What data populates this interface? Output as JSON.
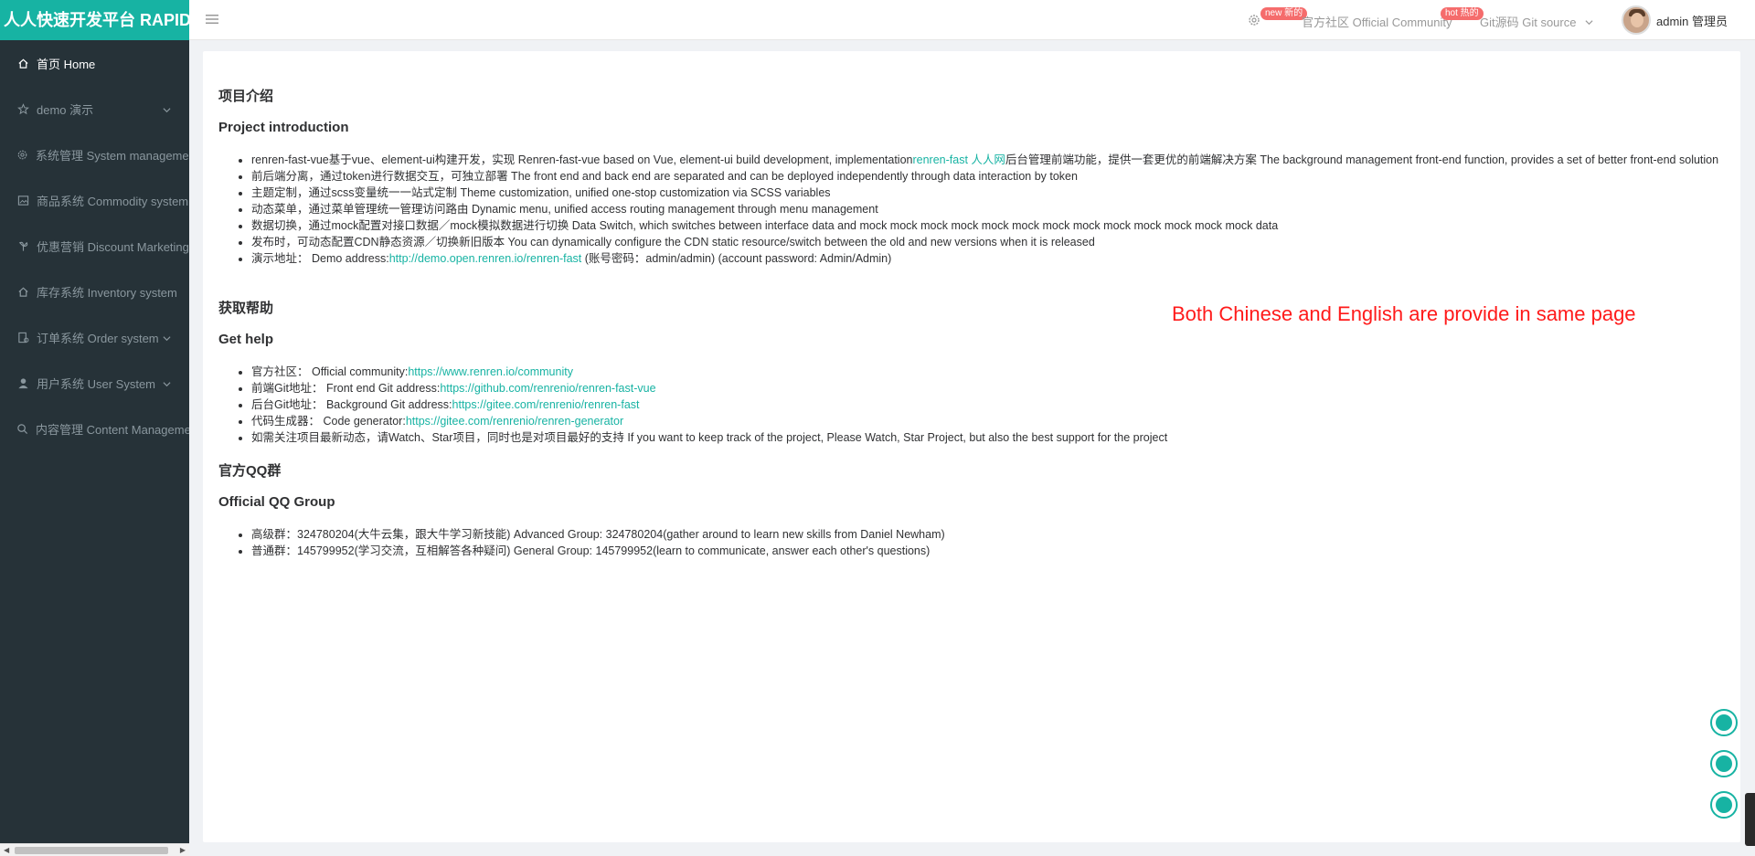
{
  "brand": {
    "title": "人人快速开发平台 RAPID"
  },
  "sidebar": {
    "items": [
      {
        "label": "首页 Home",
        "icon": "home-icon",
        "has_arrow": false,
        "active": true
      },
      {
        "label": "demo 演示",
        "icon": "star-icon",
        "has_arrow": true
      },
      {
        "label": "系统管理 System management",
        "icon": "gear-icon",
        "has_arrow": false
      },
      {
        "label": "商品系统 Commodity system",
        "icon": "picture-icon",
        "has_arrow": false
      },
      {
        "label": "优惠营销 Discount Marketing",
        "icon": "fan-icon",
        "has_arrow": false
      },
      {
        "label": "库存系统 Inventory system",
        "icon": "home-icon",
        "has_arrow": false
      },
      {
        "label": "订单系统 Order system",
        "icon": "order-icon",
        "has_arrow": true
      },
      {
        "label": "用户系统 User System",
        "icon": "user-icon",
        "has_arrow": true
      },
      {
        "label": "内容管理 Content Management",
        "icon": "search-icon",
        "has_arrow": false
      }
    ]
  },
  "topbar": {
    "community_badge": "new 新的",
    "community_label": "官方社区 Official Community",
    "git_badge": "hot 热的",
    "git_label": "Git源码 Git source",
    "username": "admin 管理员"
  },
  "content": {
    "section1": {
      "title_cn": "项目介绍",
      "title_en": "Project introduction",
      "items": [
        {
          "pre": "renren-fast-vue基于vue、element-ui构建开发，实现 Renren-fast-vue based on Vue, element-ui build development, implementation",
          "link": "renren-fast 人人网",
          "post": "后台管理前端功能，提供一套更优的前端解决方案 The background management front-end function, provides a set of better front-end solution"
        },
        {
          "pre": "前后端分离，通过token进行数据交互，可独立部署 The front end and back end are separated and can be deployed independently through data interaction by token",
          "link": "",
          "post": ""
        },
        {
          "pre": "主题定制，通过scss变量统一一站式定制 Theme customization, unified one-stop customization via SCSS variables",
          "link": "",
          "post": ""
        },
        {
          "pre": "动态菜单，通过菜单管理统一管理访问路由 Dynamic menu, unified access routing management through menu management",
          "link": "",
          "post": ""
        },
        {
          "pre": "数据切换，通过mock配置对接口数据／mock模拟数据进行切换 Data Switch, which switches between interface data and mock mock mock mock mock mock mock mock mock mock mock mock mock data",
          "link": "",
          "post": ""
        },
        {
          "pre": "发布时，可动态配置CDN静态资源／切换新旧版本 You can dynamically configure the CDN static resource/switch between the old and new versions when it is released",
          "link": "",
          "post": ""
        },
        {
          "pre": "演示地址： Demo address:",
          "link": "http://demo.open.renren.io/renren-fast",
          "post": " (账号密码：admin/admin) (account password: Admin/Admin)"
        }
      ]
    },
    "section2": {
      "title_cn": "获取帮助",
      "title_en": "Get help",
      "items": [
        {
          "pre": "官方社区： Official community:",
          "link": "https://www.renren.io/community",
          "post": ""
        },
        {
          "pre": "前端Git地址： Front end Git address:",
          "link": "https://github.com/renrenio/renren-fast-vue",
          "post": ""
        },
        {
          "pre": "后台Git地址： Background Git address:",
          "link": "https://gitee.com/renrenio/renren-fast",
          "post": ""
        },
        {
          "pre": "代码生成器： Code generator:",
          "link": "https://gitee.com/renrenio/renren-generator",
          "post": ""
        },
        {
          "pre": "如需关注项目最新动态，请Watch、Star项目，同时也是对项目最好的支持 If you want to keep track of the project, Please Watch, Star Project, but also the best support for the project",
          "link": "",
          "post": ""
        }
      ]
    },
    "section3": {
      "title_cn": "官方QQ群",
      "title_en": "Official QQ Group",
      "items": [
        {
          "pre": "高级群：324780204(大牛云集，跟大牛学习新技能) Advanced Group: 324780204(gather around to learn new skills from Daniel Newham)",
          "link": "",
          "post": ""
        },
        {
          "pre": "普通群：145799952(学习交流，互相解答各种疑问) General Group: 145799952(learn to communicate, answer each other's questions)",
          "link": "",
          "post": ""
        }
      ]
    },
    "annotation": "Both Chinese and English are provide in same page"
  },
  "colors": {
    "accent": "#17b3a3",
    "sidebar_bg": "#263238",
    "badge": "#f56c6c",
    "annotation": "#ff1a1a"
  }
}
